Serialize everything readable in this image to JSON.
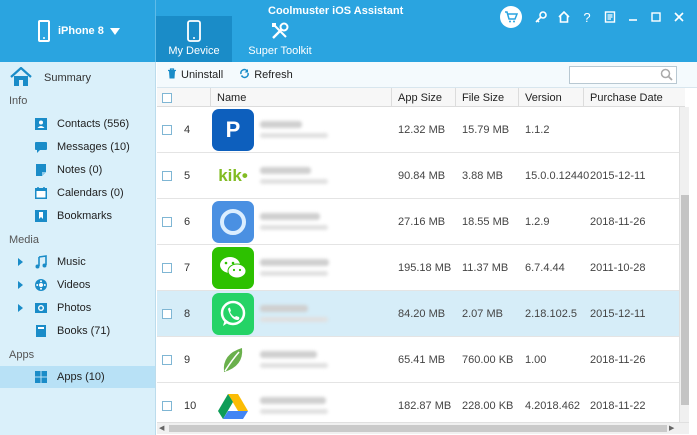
{
  "header": {
    "device_name": "iPhone 8",
    "app_title": "Coolmuster iOS Assistant",
    "tabs": [
      {
        "label": "My Device",
        "icon": "phone-icon",
        "active": true
      },
      {
        "label": "Super Toolkit",
        "icon": "tools-icon",
        "active": false
      }
    ],
    "controls": [
      "cart-icon",
      "key-icon",
      "home-icon",
      "help-icon",
      "feedback-icon",
      "minimize-icon",
      "maximize-icon",
      "close-icon"
    ],
    "help_label": "?"
  },
  "sidebar": {
    "summary": "Summary",
    "sections": {
      "info": "Info",
      "media": "Media",
      "apps": "Apps"
    },
    "items": {
      "contacts": "Contacts  (556)",
      "messages": "Messages  (10)",
      "notes": "Notes  (0)",
      "calendars": "Calendars  (0)",
      "bookmarks": "Bookmarks",
      "music": "Music",
      "videos": "Videos",
      "photos": "Photos",
      "books": "Books  (71)",
      "apps": "Apps  (10)"
    }
  },
  "toolbar": {
    "uninstall": "Uninstall",
    "refresh": "Refresh",
    "search_placeholder": ""
  },
  "table": {
    "headers": {
      "name": "Name",
      "app_size": "App Size",
      "file_size": "File Size",
      "version": "Version",
      "purchase_date": "Purchase Date"
    },
    "rows": [
      {
        "num": "4",
        "app_size": "12.32 MB",
        "file_size": "15.79 MB",
        "version": "1.1.2",
        "date": "",
        "icon_color": "#0d5fbd",
        "icon": "p-logo-icon",
        "icon_text": "P"
      },
      {
        "num": "5",
        "app_size": "90.84 MB",
        "file_size": "3.88 MB",
        "version": "15.0.0.12440",
        "date": "2015-12-11",
        "icon_color": "#ffffff",
        "icon": "kik-logo-icon",
        "icon_text": "kik•"
      },
      {
        "num": "6",
        "app_size": "27.16 MB",
        "file_size": "18.55 MB",
        "version": "1.2.9",
        "date": "2018-11-26",
        "icon_color": "#4a90e2",
        "icon": "ring-logo-icon",
        "icon_text": ""
      },
      {
        "num": "7",
        "app_size": "195.18 MB",
        "file_size": "11.37 MB",
        "version": "6.7.4.44",
        "date": "2011-10-28",
        "icon_color": "#2dc100",
        "icon": "wechat-logo-icon",
        "icon_text": ""
      },
      {
        "num": "8",
        "app_size": "84.20 MB",
        "file_size": "2.07 MB",
        "version": "2.18.102.5",
        "date": "2015-12-11",
        "icon_color": "#25d366",
        "icon": "whatsapp-logo-icon",
        "icon_text": ""
      },
      {
        "num": "9",
        "app_size": "65.41 MB",
        "file_size": "760.00 KB",
        "version": "1.00",
        "date": "2018-11-26",
        "icon_color": "#ffffff",
        "icon": "leaf-logo-icon",
        "icon_text": ""
      },
      {
        "num": "10",
        "app_size": "182.87 MB",
        "file_size": "228.00 KB",
        "version": "4.2018.462",
        "date": "2018-11-22",
        "icon_color": "#ffffff",
        "icon": "drive-logo-icon",
        "icon_text": ""
      }
    ],
    "selected_row": 4
  },
  "colors": {
    "header": "#2aa4e0",
    "active_tab": "#1a8cc8",
    "sidebar": "#daf0fa",
    "selected": "#d6edf8"
  }
}
